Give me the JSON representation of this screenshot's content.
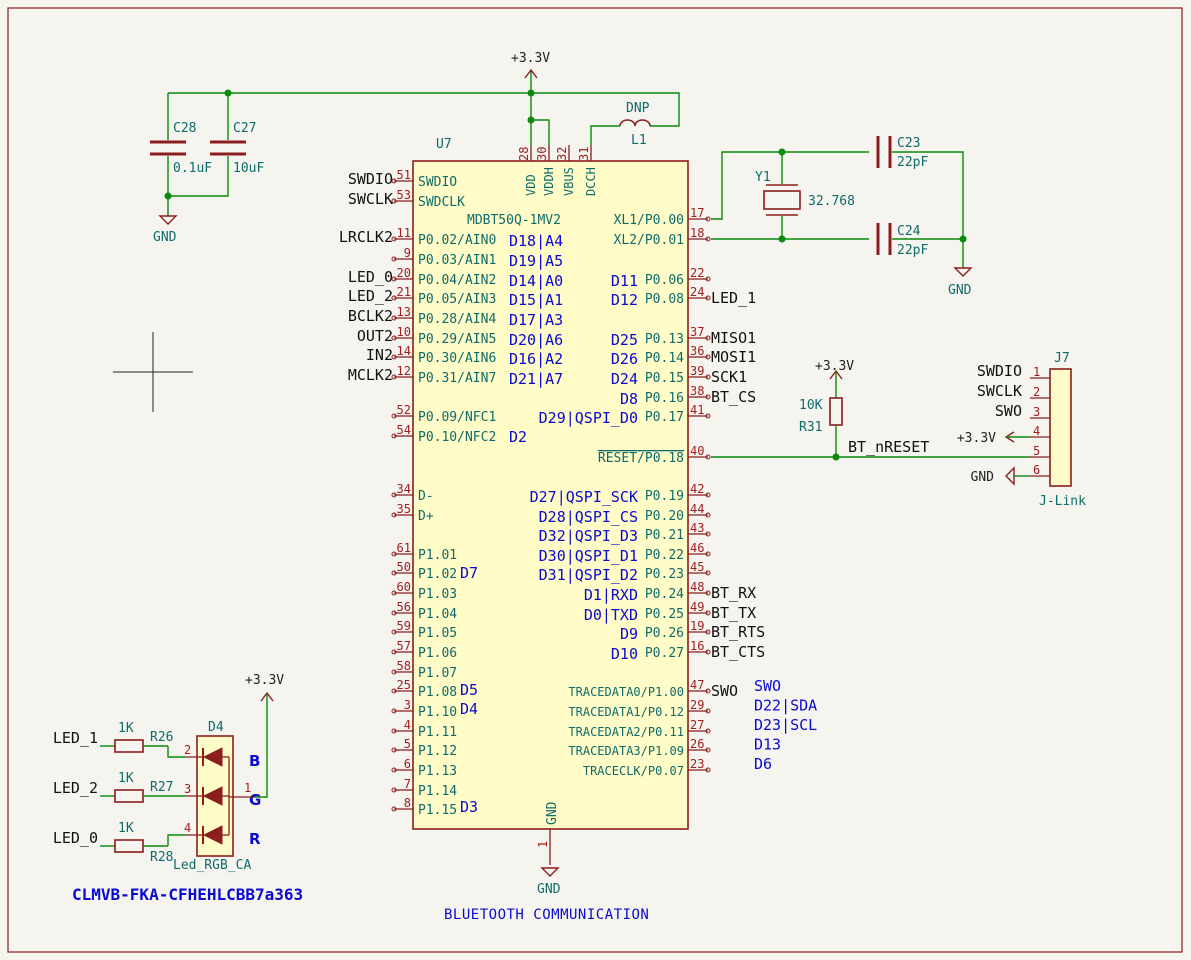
{
  "u7": {
    "ref": "U7",
    "part": "MDBT50Q-1MV2",
    "top_pins": [
      {
        "num": "28",
        "name": "VDD"
      },
      {
        "num": "30",
        "name": "VDDH"
      },
      {
        "num": "32",
        "name": "VBUS"
      },
      {
        "num": "31",
        "name": "DCCH"
      }
    ],
    "left_pins": [
      {
        "num": "51",
        "name": "SWDIO",
        "net": "SWDIO"
      },
      {
        "num": "53",
        "name": "SWDCLK",
        "net": "SWCLK"
      },
      {
        "num": "11",
        "name": "P0.02/AIN0",
        "net": "LRCLK2"
      },
      {
        "num": "9",
        "name": "P0.03/AIN1",
        "net": ""
      },
      {
        "num": "20",
        "name": "P0.04/AIN2",
        "net": "LED_0"
      },
      {
        "num": "21",
        "name": "P0.05/AIN3",
        "net": "LED_2"
      },
      {
        "num": "13",
        "name": "P0.28/AIN4",
        "net": "BCLK2"
      },
      {
        "num": "10",
        "name": "P0.29/AIN5",
        "net": "OUT2"
      },
      {
        "num": "14",
        "name": "P0.30/AIN6",
        "net": "IN2"
      },
      {
        "num": "12",
        "name": "P0.31/AIN7",
        "net": "MCLK2"
      },
      {
        "num": "52",
        "name": "P0.09/NFC1",
        "net": ""
      },
      {
        "num": "54",
        "name": "P0.10/NFC2",
        "net": ""
      },
      {
        "num": "34",
        "name": "D-",
        "net": ""
      },
      {
        "num": "35",
        "name": "D+",
        "net": ""
      },
      {
        "num": "61",
        "name": "P1.01",
        "net": ""
      },
      {
        "num": "50",
        "name": "P1.02",
        "net": ""
      },
      {
        "num": "60",
        "name": "P1.03",
        "net": ""
      },
      {
        "num": "56",
        "name": "P1.04",
        "net": ""
      },
      {
        "num": "59",
        "name": "P1.05",
        "net": ""
      },
      {
        "num": "57",
        "name": "P1.06",
        "net": ""
      },
      {
        "num": "58",
        "name": "P1.07",
        "net": ""
      },
      {
        "num": "25",
        "name": "P1.08",
        "net": ""
      },
      {
        "num": "3",
        "name": "P1.10",
        "net": ""
      },
      {
        "num": "4",
        "name": "P1.11",
        "net": ""
      },
      {
        "num": "5",
        "name": "P1.12",
        "net": ""
      },
      {
        "num": "6",
        "name": "P1.13",
        "net": ""
      },
      {
        "num": "7",
        "name": "P1.14",
        "net": ""
      },
      {
        "num": "8",
        "name": "P1.15",
        "net": ""
      }
    ],
    "right_pins": [
      {
        "num": "17",
        "name": "XL1/P0.00",
        "net": ""
      },
      {
        "num": "18",
        "name": "XL2/P0.01",
        "net": ""
      },
      {
        "num": "22",
        "name": "P0.06",
        "net": ""
      },
      {
        "num": "24",
        "name": "P0.08",
        "net": "LED_1"
      },
      {
        "num": "37",
        "name": "P0.13",
        "net": "MISO1"
      },
      {
        "num": "36",
        "name": "P0.14",
        "net": "MOSI1"
      },
      {
        "num": "39",
        "name": "P0.15",
        "net": "SCK1"
      },
      {
        "num": "38",
        "name": "P0.16",
        "net": "BT_CS"
      },
      {
        "num": "41",
        "name": "P0.17",
        "net": ""
      },
      {
        "num": "40",
        "name": "RESET/P0.18",
        "net": ""
      },
      {
        "num": "42",
        "name": "P0.19",
        "net": ""
      },
      {
        "num": "44",
        "name": "P0.20",
        "net": ""
      },
      {
        "num": "43",
        "name": "P0.21",
        "net": ""
      },
      {
        "num": "46",
        "name": "P0.22",
        "net": ""
      },
      {
        "num": "45",
        "name": "P0.23",
        "net": ""
      },
      {
        "num": "48",
        "name": "P0.24",
        "net": "BT_RX"
      },
      {
        "num": "49",
        "name": "P0.25",
        "net": "BT_TX"
      },
      {
        "num": "19",
        "name": "P0.26",
        "net": "BT_RTS"
      },
      {
        "num": "16",
        "name": "P0.27",
        "net": "BT_CTS"
      },
      {
        "num": "47",
        "name": "TRACEDATA0/P1.00",
        "net": "SWO"
      },
      {
        "num": "29",
        "name": "TRACEDATA1/P0.12",
        "net": ""
      },
      {
        "num": "27",
        "name": "TRACEDATA2/P0.11",
        "net": ""
      },
      {
        "num": "26",
        "name": "TRACEDATA3/P1.09",
        "net": ""
      },
      {
        "num": "23",
        "name": "TRACECLK/P0.07",
        "net": ""
      }
    ],
    "bottom_pin": {
      "num": "1",
      "name": "GND"
    },
    "inner_left_aliases": [
      "D18|A4",
      "D19|A5",
      "D14|A0",
      "D15|A1",
      "D17|A3",
      "D20|A6",
      "D16|A2",
      "D21|A7"
    ],
    "inner_right_aliases": [
      "D11",
      "D12",
      "D25",
      "D26",
      "D24",
      "D8",
      "D29|QSPI_D0",
      "D27|QSPI_SCK",
      "D28|QSPI_CS",
      "D32|QSPI_D3",
      "D30|QSPI_D1",
      "D31|QSPI_D2",
      "D1|RXD",
      "D0|TXD",
      "D9",
      "D10"
    ],
    "inner_misc": [
      "D2",
      "D7",
      "D5",
      "D4",
      "D3"
    ]
  },
  "swo_aliases": [
    "SWO",
    "D22|SDA",
    "D23|SCL",
    "D13",
    "D6"
  ],
  "caps": {
    "c28": {
      "ref": "C28",
      "value": "0.1uF"
    },
    "c27": {
      "ref": "C27",
      "value": "10uF"
    },
    "c23": {
      "ref": "C23",
      "value": "22pF"
    },
    "c24": {
      "ref": "C24",
      "value": "22pF"
    }
  },
  "inductor": {
    "ref": "L1",
    "value": "DNP"
  },
  "crystal": {
    "ref": "Y1",
    "value": "32.768"
  },
  "r31": {
    "ref": "R31",
    "value": "10K"
  },
  "bt_nreset": "BT_nRESET",
  "power": {
    "v33": "+3.3V",
    "gnd": "GND"
  },
  "j7": {
    "ref": "J7",
    "value": "J-Link",
    "pins": [
      {
        "num": "1",
        "net": "SWDIO"
      },
      {
        "num": "2",
        "net": "SWCLK"
      },
      {
        "num": "3",
        "net": "SWO"
      },
      {
        "num": "4",
        "net": "+3.3V"
      },
      {
        "num": "5",
        "net": ""
      },
      {
        "num": "6",
        "net": "GND"
      }
    ]
  },
  "led": {
    "ref": "D4",
    "value": "Led_RGB_CA",
    "colors": [
      "B",
      "G",
      "R"
    ],
    "pins": [
      "2",
      "3",
      "4",
      "1"
    ],
    "resistors": [
      {
        "ref": "R26",
        "value": "1K",
        "net": "LED_1"
      },
      {
        "ref": "R27",
        "value": "1K",
        "net": "LED_2"
      },
      {
        "ref": "R28",
        "value": "1K",
        "net": "LED_0"
      }
    ],
    "part_number": "CLMVB-FKA-CFHEHLCBB7a363"
  },
  "sheet_title": "BLUETOOTH COMMUNICATION"
}
